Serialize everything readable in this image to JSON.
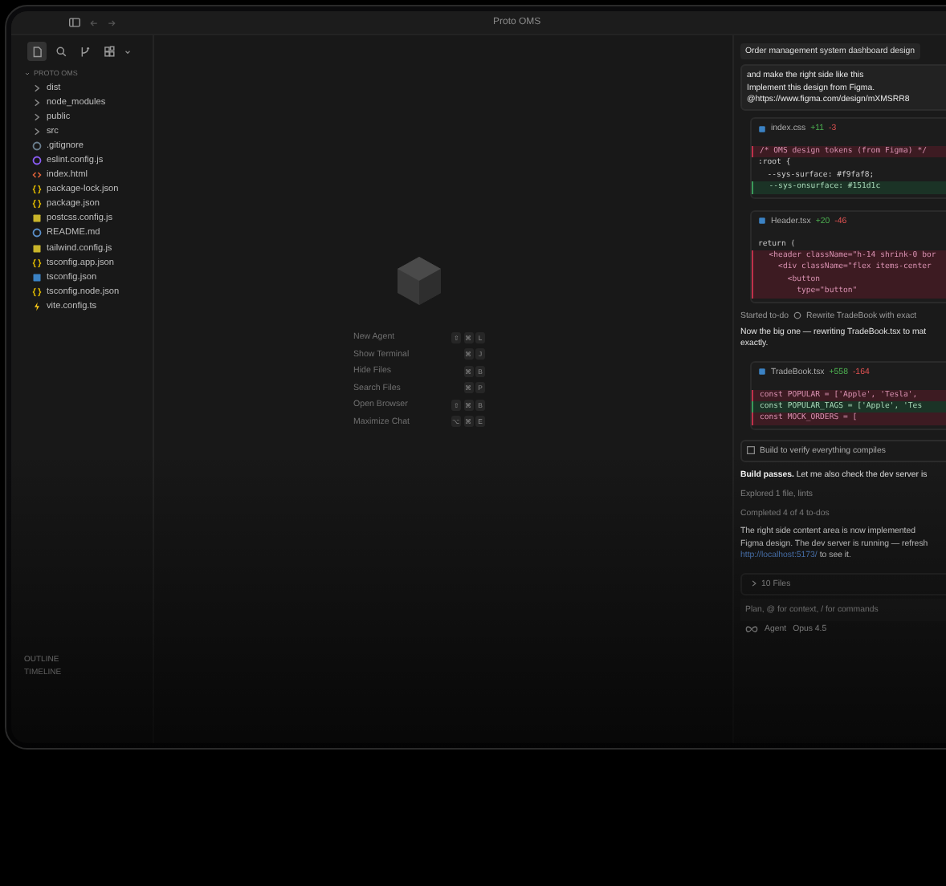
{
  "window": {
    "title": "Proto OMS"
  },
  "sidebar": {
    "tools": [
      {
        "kind": "files",
        "selected": true
      },
      {
        "kind": "search",
        "selected": false
      },
      {
        "kind": "branch",
        "selected": false
      },
      {
        "kind": "extensions",
        "selected": false
      }
    ],
    "project": "PROTO OMS",
    "files": [
      {
        "name": "dist",
        "kind": "folder"
      },
      {
        "name": "node_modules",
        "kind": "folder"
      },
      {
        "name": "public",
        "kind": "folder"
      },
      {
        "name": "src",
        "kind": "folder"
      },
      {
        "name": ".gitignore",
        "kind": "gitignore"
      },
      {
        "name": "eslint.config.js",
        "kind": "eslint"
      },
      {
        "name": "index.html",
        "kind": "html"
      },
      {
        "name": "package-lock.json",
        "kind": "json"
      },
      {
        "name": "package.json",
        "kind": "json"
      },
      {
        "name": "postcss.config.js",
        "kind": "js"
      },
      {
        "name": "README.md",
        "kind": "info"
      },
      {
        "name": "tailwind.config.js",
        "kind": "js"
      },
      {
        "name": "tsconfig.app.json",
        "kind": "json"
      },
      {
        "name": "tsconfig.json",
        "kind": "ts"
      },
      {
        "name": "tsconfig.node.json",
        "kind": "json"
      },
      {
        "name": "vite.config.ts",
        "kind": "vite"
      }
    ],
    "sections": [
      "OUTLINE",
      "TIMELINE"
    ]
  },
  "shortcuts": [
    {
      "label": "New Agent",
      "keys": [
        "⇧",
        "⌘",
        "L"
      ]
    },
    {
      "label": "Show Terminal",
      "keys": [
        "⌘",
        "J"
      ]
    },
    {
      "label": "Hide Files",
      "keys": [
        "⌘",
        "B"
      ]
    },
    {
      "label": "Search Files",
      "keys": [
        "⌘",
        "P"
      ]
    },
    {
      "label": "Open Browser",
      "keys": [
        "⇧",
        "⌘",
        "B"
      ]
    },
    {
      "label": "Maximize Chat",
      "keys": [
        "⌥",
        "⌘",
        "E"
      ]
    }
  ],
  "chat": {
    "title": "Order management system dashboard design",
    "user_message": [
      "and make the right side like this",
      "Implement this design from Figma.",
      "@https://www.figma.com/design/mXMSRR8"
    ],
    "items": [
      {
        "kind": "diff",
        "file": "index.css",
        "added": "+11",
        "removed": "-3",
        "lines": [
          {
            "text": "/* OMS design tokens (from Figma) */",
            "added": false,
            "removed": true
          },
          {
            "text": ":root {",
            "added": false,
            "removed": false
          },
          {
            "text": "  --sys-surface: #f9faf8;",
            "added": false,
            "removed": false
          },
          {
            "text": "  --sys-onsurface: #151d1c",
            "added": true,
            "removed": false
          }
        ]
      },
      {
        "kind": "diff",
        "file": "Header.tsx",
        "added": "+20",
        "removed": "-46",
        "lines": [
          {
            "text": "return (",
            "added": false,
            "removed": false
          },
          {
            "text": "  <header className=\"h-14 shrink-0 bor",
            "added": false,
            "removed": true
          },
          {
            "text": "    <div className=\"flex items-center",
            "added": false,
            "removed": true
          },
          {
            "text": "      <button",
            "added": false,
            "removed": true
          },
          {
            "text": "        type=\"button\"",
            "added": false,
            "removed": true
          }
        ]
      },
      {
        "kind": "todo",
        "label": "Started to-do",
        "text": "Rewrite TradeBook with exact"
      },
      {
        "kind": "text",
        "text": "Now the big one — rewriting TradeBook.tsx to mat exactly."
      },
      {
        "kind": "diff",
        "file": "TradeBook.tsx",
        "added": "+558",
        "removed": "-164",
        "lines": [
          {
            "text": "const POPULAR = ['Apple', 'Tesla',",
            "added": false,
            "removed": true
          },
          {
            "text": "const POPULAR_TAGS = ['Apple', 'Tes",
            "added": true,
            "removed": false
          },
          {
            "text": "const MOCK_ORDERS = [",
            "added": false,
            "removed": true
          }
        ]
      },
      {
        "kind": "command",
        "text": "Build to verify everything compiles"
      },
      {
        "kind": "text",
        "text": "**Build passes.** Let me also check the dev server is"
      },
      {
        "kind": "note",
        "text": "Explored 1 file, lints"
      },
      {
        "kind": "note",
        "text": "Completed 4 of 4 to-dos"
      },
      {
        "kind": "text",
        "text": "The right side content area is now implemented Figma design. The dev server is running — refresh",
        "link": "http://localhost:5173/",
        "after": "to see it."
      },
      {
        "kind": "files",
        "text": "10 Files"
      }
    ],
    "placeholder": "Plan, @ for context, / for commands",
    "mode": "Agent",
    "model": "Opus 4.5"
  }
}
